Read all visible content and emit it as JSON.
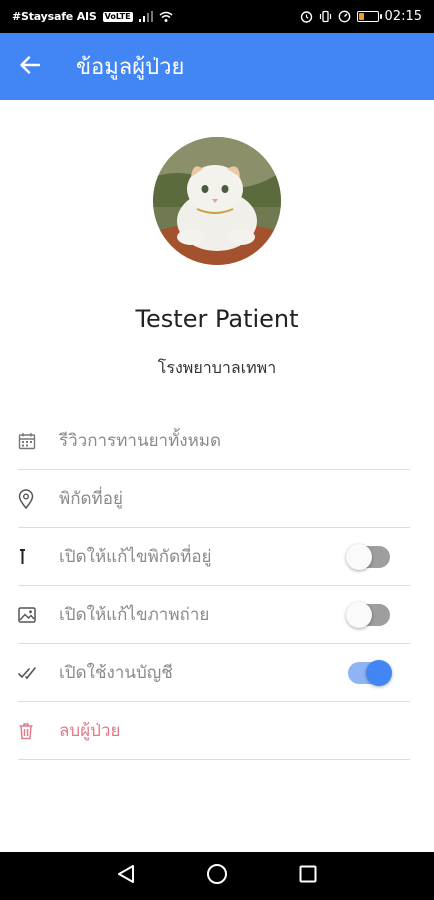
{
  "status_bar": {
    "carrier": "#Staysafe AIS",
    "network_badge": "VoLTE",
    "time": "02:15",
    "battery_level": 0.3,
    "icons": [
      "signal-icon",
      "wifi-icon",
      "alarm-icon",
      "vibrate-icon",
      "speed-icon",
      "battery-icon"
    ]
  },
  "app_bar": {
    "title": "ข้อมูลผู้ป่วย",
    "background": "#4285f4"
  },
  "profile": {
    "name": "Tester Patient",
    "hospital": "โรงพยาบาลเทพา"
  },
  "menu": [
    {
      "icon": "calendar-icon",
      "label": "รีวิวการทานยาทั้งหมด"
    },
    {
      "icon": "location-pin-icon",
      "label": "พิกัดที่อยู่"
    },
    {
      "icon": "info-icon",
      "label": "เปิดให้แก้ไขพิกัดที่อยู่",
      "toggle": false
    },
    {
      "icon": "image-icon",
      "label": "เปิดให้แก้ไขภาพถ่าย",
      "toggle": false
    },
    {
      "icon": "double-check-icon",
      "label": "เปิดใช้งานบัญชี",
      "toggle": true
    },
    {
      "icon": "trash-icon",
      "label": "ลบผู้ป่วย",
      "danger": true,
      "color": "#e07b8a"
    }
  ],
  "nav_bar": [
    "back-triangle-icon",
    "home-circle-icon",
    "recents-square-icon"
  ]
}
